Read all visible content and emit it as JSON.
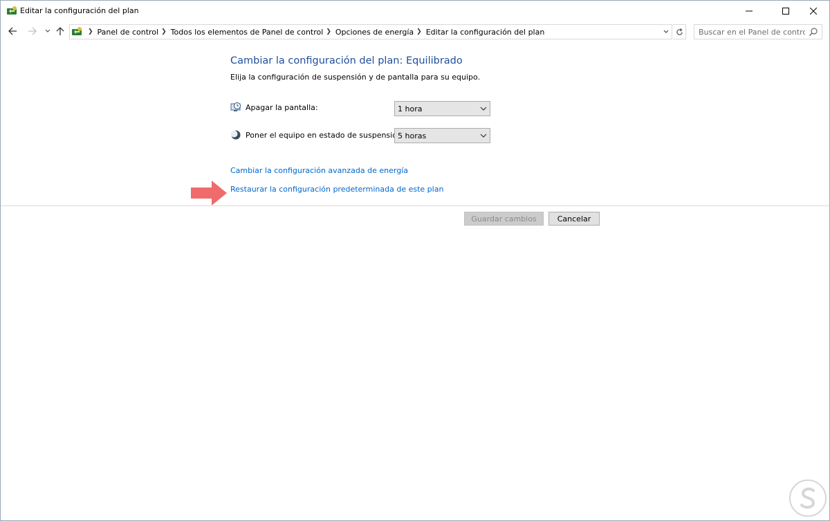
{
  "window": {
    "title": "Editar la configuración del plan",
    "controls": {
      "minimize": "minimize-icon",
      "maximize": "maximize-icon",
      "close": "close-icon"
    }
  },
  "navigation": {
    "breadcrumbs": [
      "Panel de control",
      "Todos los elementos de Panel de control",
      "Opciones de energía",
      "Editar la configuración del plan"
    ],
    "search_placeholder": "Buscar en el Panel de control"
  },
  "main": {
    "heading": "Cambiar la configuración del plan: Equilibrado",
    "subtitle": "Elija la configuración de suspensión y de pantalla para su equipo.",
    "settings": [
      {
        "label": "Apagar la pantalla:",
        "value": "1 hora",
        "icon": "monitor-clock-icon"
      },
      {
        "label": "Poner el equipo en estado de suspensión:",
        "value": "5 horas",
        "icon": "moon-sleep-icon"
      }
    ],
    "links": {
      "advanced": "Cambiar la configuración avanzada de energía",
      "restore": "Restaurar la configuración predeterminada de este plan"
    },
    "buttons": {
      "save": "Guardar cambios",
      "cancel": "Cancelar"
    }
  },
  "annotation": {
    "icon": "arrow-right-icon",
    "color": "#f06b6b"
  },
  "colors": {
    "heading": "#1e4e9b",
    "link": "#0066cc"
  }
}
